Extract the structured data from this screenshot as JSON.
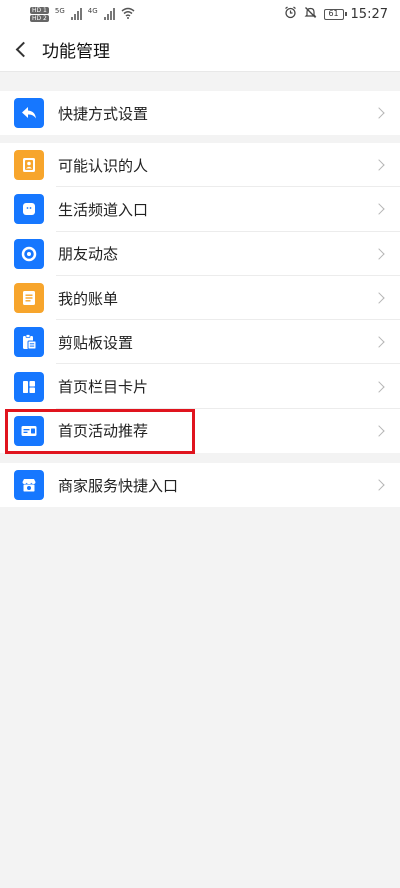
{
  "status_bar": {
    "sim1": "HD 1",
    "sim2": "HD 2",
    "net1": "5G",
    "net2": "4G",
    "battery": "61",
    "time": "15:27"
  },
  "header": {
    "title": "功能管理"
  },
  "groups": [
    {
      "items": [
        {
          "label": "快捷方式设置",
          "icon": "share-back-icon"
        }
      ]
    },
    {
      "items": [
        {
          "label": "可能认识的人",
          "icon": "contact-card-icon"
        },
        {
          "label": "生活频道入口",
          "icon": "life-channel-icon"
        },
        {
          "label": "朋友动态",
          "icon": "friend-feed-icon"
        },
        {
          "label": "我的账单",
          "icon": "bill-icon"
        },
        {
          "label": "剪贴板设置",
          "icon": "clipboard-icon"
        },
        {
          "label": "首页栏目卡片",
          "icon": "grid-card-icon"
        },
        {
          "label": "首页活动推荐",
          "icon": "banner-card-icon"
        }
      ]
    },
    {
      "items": [
        {
          "label": "商家服务快捷入口",
          "icon": "store-icon"
        }
      ]
    }
  ],
  "colors": {
    "accent_blue": "#1677ff",
    "accent_orange": "#f7a52c",
    "highlight_red": "#e0141e",
    "background": "#f3f3f3"
  }
}
